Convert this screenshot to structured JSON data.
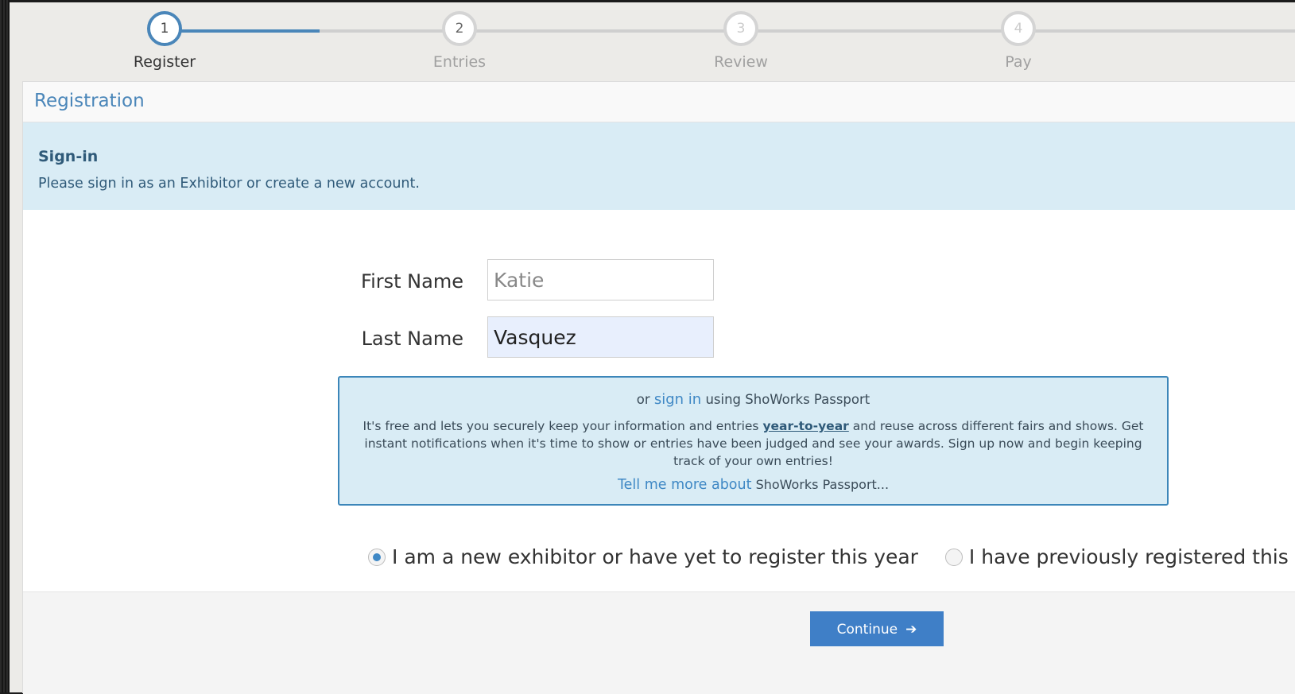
{
  "progress": {
    "steps": [
      {
        "number": "1",
        "label": "Register"
      },
      {
        "number": "2",
        "label": "Entries"
      },
      {
        "number": "3",
        "label": "Review"
      },
      {
        "number": "4",
        "label": "Pay"
      }
    ],
    "active_step": 1
  },
  "panel": {
    "title": "Registration",
    "signin_title": "Sign-in",
    "signin_text": "Please sign in as an Exhibitor or create a new account."
  },
  "form": {
    "first_name_label": "First Name",
    "first_name_placeholder": "Katie",
    "last_name_label": "Last Name",
    "last_name_value": "Vasquez"
  },
  "passport": {
    "or_text": "or",
    "sign_in_link": "sign in",
    "using_text": "using ShoWorks Passport",
    "desc_before": "It's free and lets you securely keep your information and entries ",
    "desc_emphasis": "year-to-year",
    "desc_after": " and reuse across different fairs and shows. Get instant notifications when it's time to show or entries have been judged and see your awards. Sign up now and begin keeping track of your own entries!",
    "tell_more_link": "Tell me more about",
    "tell_more_suffix": "ShoWorks Passport..."
  },
  "registration_options": {
    "new_exhibitor": "I am a new exhibitor or have yet to register this year",
    "previously_registered": "I have previously registered this year",
    "selected": "new_exhibitor"
  },
  "actions": {
    "continue_label": "Continue",
    "continue_icon": "arrow-right-icon"
  },
  "colors": {
    "accent": "#4a86b9",
    "info_bg": "#d9ecf5",
    "button": "#3f7fc7"
  }
}
